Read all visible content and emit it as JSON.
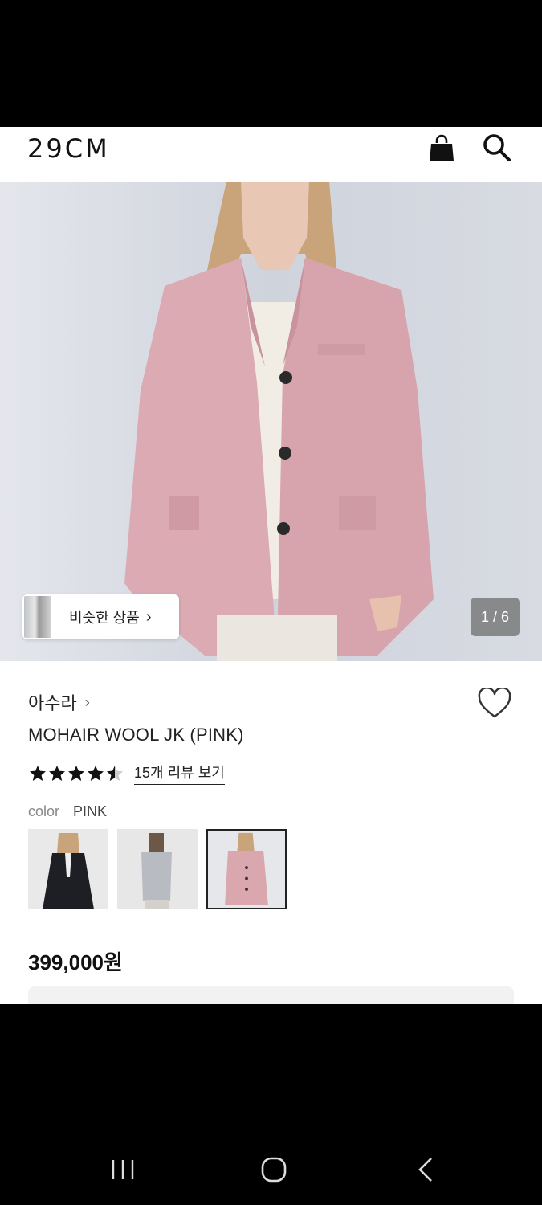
{
  "header": {
    "logo": "29CM",
    "bag_icon": "shopping-bag-icon",
    "search_icon": "search-icon"
  },
  "gallery": {
    "similar_label": "비슷한 상품",
    "similar_chevron": "›",
    "counter": "1 / 6"
  },
  "product": {
    "brand": "아수라",
    "brand_chevron": "›",
    "title": "MOHAIR WOOL JK (PINK)",
    "rating_stars": 4.5,
    "review_link": "15개 리뷰 보기",
    "color_label": "color",
    "color_value": "PINK",
    "swatches": [
      {
        "color": "#1e1f24",
        "selected": false
      },
      {
        "color": "#b8bcc2",
        "selected": false
      },
      {
        "color": "#d9a7ad",
        "selected": true
      }
    ],
    "price": "399,000원"
  },
  "colors": {
    "jacket_pink": "#dbaab2",
    "background": "#d7dbe3",
    "accent": "#111111"
  },
  "system_nav": {
    "recents_icon": "recents-icon",
    "home_icon": "home-icon",
    "back_icon": "back-icon"
  }
}
